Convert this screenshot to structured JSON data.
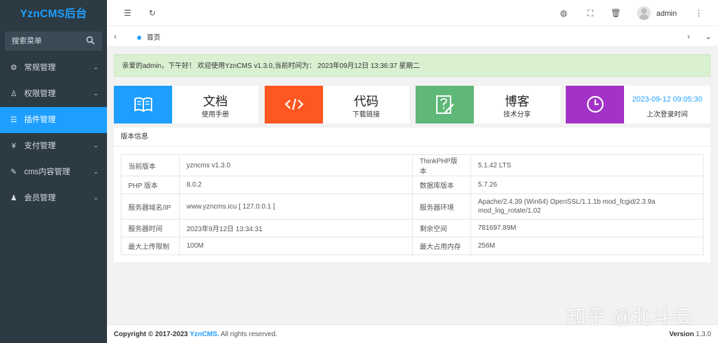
{
  "app": {
    "logo_text": "YznCMS后台"
  },
  "sidebar": {
    "search_placeholder": "搜索菜单",
    "items": [
      {
        "label": "常规管理",
        "icon": "gear-icon"
      },
      {
        "label": "权限管理",
        "icon": "user-key-icon"
      },
      {
        "label": "插件管理",
        "icon": "sliders-icon",
        "active": true
      },
      {
        "label": "支付管理",
        "icon": "yen-icon"
      },
      {
        "label": "cms内容管理",
        "icon": "edit-icon"
      },
      {
        "label": "会员管理",
        "icon": "user-icon"
      }
    ]
  },
  "header": {
    "username": "admin",
    "icons": [
      "menu-fold-icon",
      "refresh-icon",
      "globe-icon",
      "fullscreen-icon",
      "trash-icon",
      "more-vertical-icon"
    ]
  },
  "tabs": {
    "home_label": "首页"
  },
  "notice": {
    "text": "亲爱的admin，下午好！ 欢迎使用YznCMS v1.3.0,当前时间为： 2023年09月12日 13:36:37    星期二"
  },
  "cards": [
    {
      "title": "文档",
      "subtitle": "使用手册",
      "icon": "book-icon",
      "color": "#1e9fff"
    },
    {
      "title": "代码",
      "subtitle": "下载链接",
      "icon": "code-icon",
      "color": "#ff5722"
    },
    {
      "title": "博客",
      "subtitle": "技术分享",
      "icon": "edit-note-icon",
      "color": "#5fb878"
    },
    {
      "title": "2023-09-12 09:05:30",
      "subtitle": "上次登录时间",
      "icon": "clock-icon",
      "color": "#a233c6"
    }
  ],
  "version_panel": {
    "title": "版本信息",
    "rows": [
      [
        "当前版本",
        "yzncms v1.3.0",
        "ThinkPHP版本",
        "5.1.42 LTS"
      ],
      [
        "PHP 版本",
        "8.0.2",
        "数据库版本",
        "5.7.26"
      ],
      [
        "服务器域名/IP",
        "www.yzncms.icu [ 127.0.0.1 ]",
        "服务器环境",
        "Apache/2.4.39 (Win64) OpenSSL/1.1.1b mod_fcgid/2.3.9a mod_log_rotate/1.02"
      ],
      [
        "服务器时间",
        "2023年9月12日 13:34:31",
        "剩余空间",
        "781697.89M"
      ],
      [
        "最大上传限制",
        "100M",
        "最大占用内存",
        "256M"
      ]
    ]
  },
  "footer": {
    "copyright_prefix": "Copyright © 2017-2023",
    "brand": "YznCMS.",
    "rights": "All rights reserved.",
    "version_label": "Version",
    "version": "1.3.0"
  },
  "watermark": "知乎 @北斗云"
}
